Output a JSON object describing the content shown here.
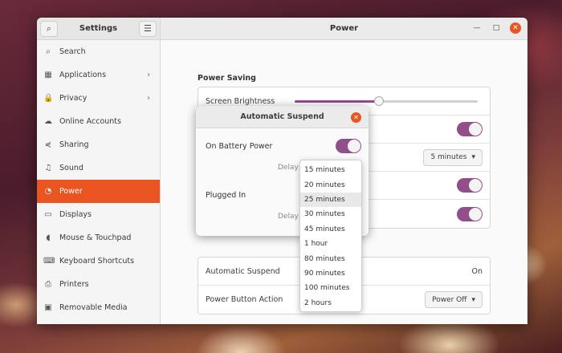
{
  "settings_title": "Settings",
  "page_title": "Power",
  "sidebar": {
    "items": [
      {
        "label": "Search",
        "icon": "search-icon",
        "glyph": "⌕"
      },
      {
        "label": "Applications",
        "icon": "applications-icon",
        "glyph": "▦",
        "chevron": "›"
      },
      {
        "label": "Privacy",
        "icon": "privacy-lock-icon",
        "glyph": "🔒",
        "chevron": "›"
      },
      {
        "label": "Online Accounts",
        "icon": "cloud-icon",
        "glyph": "☁"
      },
      {
        "label": "Sharing",
        "icon": "share-icon",
        "glyph": "⋞"
      },
      {
        "label": "Sound",
        "icon": "music-note-icon",
        "glyph": "♫"
      },
      {
        "label": "Power",
        "icon": "power-icon",
        "glyph": "◔",
        "active": true
      },
      {
        "label": "Displays",
        "icon": "display-icon",
        "glyph": "▭"
      },
      {
        "label": "Mouse & Touchpad",
        "icon": "mouse-icon",
        "glyph": "◖"
      },
      {
        "label": "Keyboard Shortcuts",
        "icon": "keyboard-icon",
        "glyph": "⌨"
      },
      {
        "label": "Printers",
        "icon": "printer-icon",
        "glyph": "⎙"
      },
      {
        "label": "Removable Media",
        "icon": "media-icon",
        "glyph": "▣"
      }
    ]
  },
  "power_saving": {
    "heading": "Power Saving",
    "brightness_label": "Screen Brightness",
    "brightness_level": 0.46,
    "blank_screen_value": "5 minutes"
  },
  "suspend": {
    "automatic_suspend_label": "Automatic Suspend",
    "automatic_suspend_value": "On",
    "power_button_label": "Power Button Action",
    "power_button_value": "Power Off"
  },
  "dialog": {
    "title": "Automatic Suspend",
    "battery_label": "On Battery Power",
    "delay_label": "Delay",
    "plugged_label": "Plugged In"
  },
  "delay_options": [
    "15 minutes",
    "20 minutes",
    "25 minutes",
    "30 minutes",
    "45 minutes",
    "1 hour",
    "80 minutes",
    "90 minutes",
    "100 minutes",
    "2 hours"
  ],
  "highlighted_option": "25 minutes",
  "colors": {
    "accent": "#e95420",
    "toggle_on": "#924d8b"
  }
}
